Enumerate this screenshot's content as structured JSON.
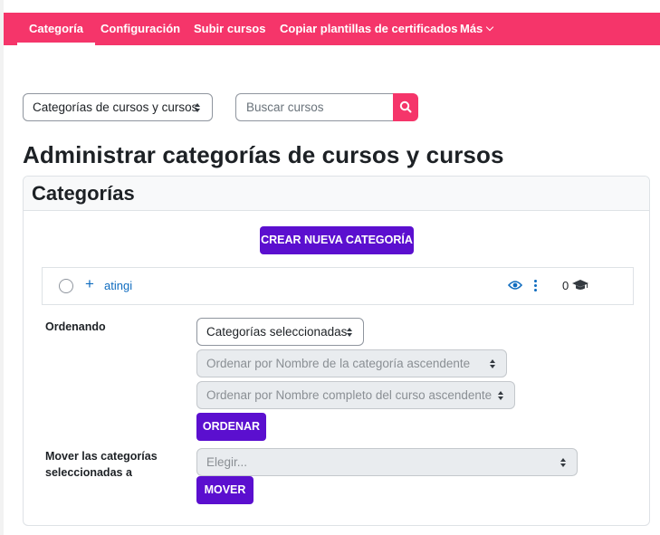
{
  "nav": {
    "items": [
      {
        "label": "Categoría",
        "active": true
      },
      {
        "label": "Configuración"
      },
      {
        "label": "Subir cursos"
      },
      {
        "label": "Copiar plantillas de certificados"
      },
      {
        "label": "Más"
      }
    ],
    "color": "#f5356a"
  },
  "toolbar": {
    "view_select": "Categorías de cursos y cursos",
    "search_placeholder": "Buscar cursos"
  },
  "page_title": "Administrar categorías de cursos y cursos",
  "categories": {
    "title": "Categorías",
    "create_button": "CREAR NUEVA CATEGORÍA",
    "items": [
      {
        "name": "atingi",
        "course_count": "0"
      }
    ]
  },
  "sort": {
    "label": "Ordenando",
    "scope_select": "Categorías seleccionadas",
    "category_order_select": "Ordenar por Nombre de la categoría ascendente",
    "course_order_select": "Ordenar por Nombre completo del curso ascendente",
    "button": "ORDENAR"
  },
  "move": {
    "label": "Mover las categorías seleccionadas a",
    "select": "Elegir...",
    "button": "MOVER"
  },
  "accent_color": "#5b0fcf"
}
